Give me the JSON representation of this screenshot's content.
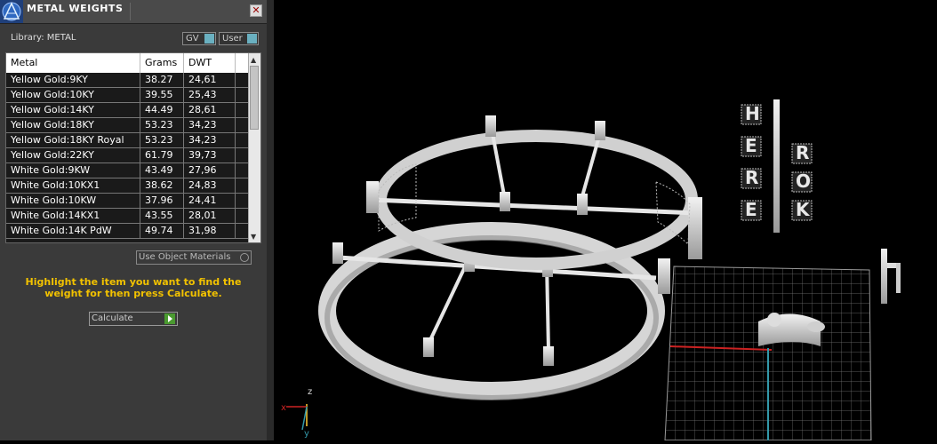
{
  "panel": {
    "title": "METAL WEIGHTS",
    "close_label": "✕",
    "library_label": "Library: METAL",
    "toggles": {
      "gv": "GV",
      "user": "User"
    },
    "table": {
      "headers": {
        "metal": "Metal",
        "grams": "Grams",
        "dwt": "DWT"
      },
      "rows": [
        [
          "Yellow Gold:9KY",
          "38.27",
          "24,61"
        ],
        [
          "Yellow Gold:10KY",
          "39.55",
          "25,43"
        ],
        [
          "Yellow Gold:14KY",
          "44.49",
          "28,61"
        ],
        [
          "Yellow Gold:18KY",
          "53.23",
          "34,23"
        ],
        [
          "Yellow Gold:18KY Royal",
          "53.23",
          "34,23"
        ],
        [
          "Yellow Gold:22KY",
          "61.79",
          "39,73"
        ],
        [
          "White Gold:9KW",
          "43.49",
          "27,96"
        ],
        [
          "White Gold:10KX1",
          "38.62",
          "24,83"
        ],
        [
          "White Gold:10KW",
          "37.96",
          "24,41"
        ],
        [
          "White Gold:14KX1",
          "43.55",
          "28,01"
        ],
        [
          "White Gold:14K PdW",
          "49.74",
          "31,98"
        ]
      ]
    },
    "use_object_materials_label": "Use Object Materials",
    "instructions": "Highlight the item you want to find the weight for then press Calculate.",
    "calculate_label": "Calculate"
  },
  "viewport": {
    "axis_labels": {
      "x": "x",
      "y": "y",
      "z": "z"
    },
    "letters_left": [
      "H",
      "E",
      "R",
      "E"
    ],
    "letters_right": [
      "R",
      "O",
      "K"
    ]
  },
  "colors": {
    "panel_bg": "#3a3a3a",
    "instruction_text": "#f2c200",
    "toggle_accent": "#6ab0c0",
    "axis_x": "#cc2222",
    "axis_y": "#3399aa",
    "axis_z": "#ffcc33"
  }
}
